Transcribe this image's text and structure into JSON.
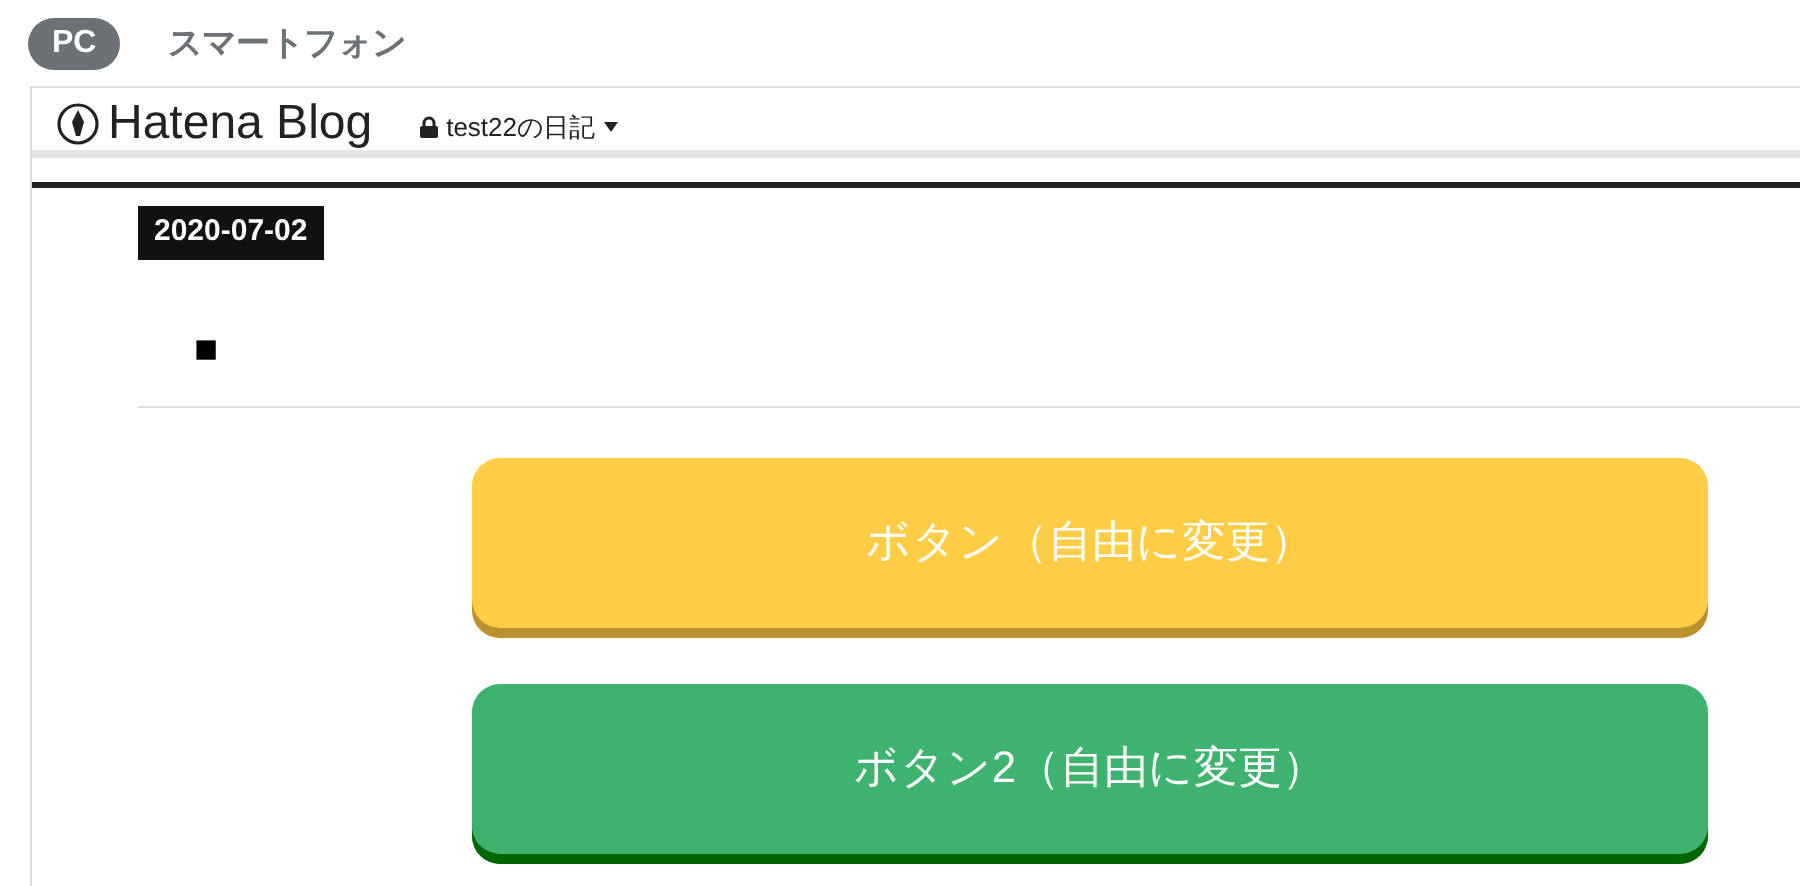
{
  "view_tabs": [
    {
      "label": "PC",
      "selected": true
    },
    {
      "label": "スマートフォン",
      "selected": false
    }
  ],
  "header": {
    "logo": "Hatena Blog",
    "blog_name": "test22の日記",
    "locked": true
  },
  "entry": {
    "date": "2020-07-02",
    "heading_mark": "■"
  },
  "buttons": [
    {
      "label": "ボタン（自由に変更）",
      "color": "#fecc45",
      "kind": "first"
    },
    {
      "label": "ボタン2（自由に変更）",
      "color": "#3eb370",
      "kind": "second"
    }
  ]
}
